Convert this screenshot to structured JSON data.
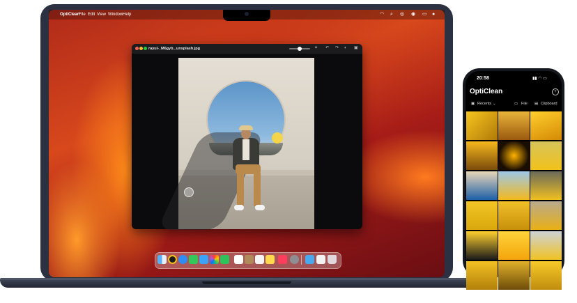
{
  "mac": {
    "menubar": {
      "items": [
        "OptiClean",
        "File",
        "Edit",
        "View",
        "Window",
        "Help"
      ],
      "status_icons": [
        "wifi-icon",
        "search-icon",
        "control-center-icon",
        "battery-icon"
      ]
    },
    "window": {
      "title": "rayul-_M6gyb...unsplash.jpg",
      "toolbar_icons": [
        "zoom-slider",
        "magic-wand-icon",
        "undo-icon",
        "redo-icon",
        "image-icon"
      ]
    },
    "dock": {
      "apps": [
        "Finder",
        "OptiClean",
        "Safari",
        "Messages",
        "Mail",
        "Photos",
        "FaceTime",
        "Calendar",
        "Contacts",
        "Reminders",
        "Notes",
        "Music",
        "System Settings",
        "Downloads",
        "Documents",
        "Trash"
      ]
    }
  },
  "phone": {
    "time": "20:58",
    "app_title": "OptiClean",
    "tabs": {
      "recents": "Recents",
      "file": "File",
      "clipboard": "Clipboard"
    },
    "photos_count_rows": 6,
    "photos_count_cols": 3
  },
  "colors": {
    "accent_yellow": "#f2c21b",
    "wallpaper_orange": "#e5541d",
    "laptop_body": "#2b3140"
  }
}
